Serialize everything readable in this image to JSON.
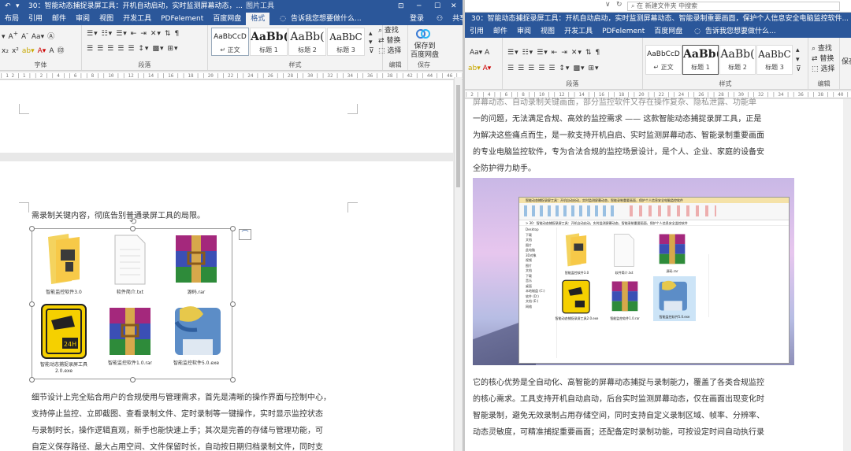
{
  "left": {
    "title": "30：智能动态捕捉录屏工具：开机自动启动，实时监测屏幕动态，...",
    "picture_tools": "图片工具",
    "menu": [
      "布局",
      "引用",
      "邮件",
      "审阅",
      "视图",
      "开发工具",
      "PDFelement",
      "百度网盘",
      "格式"
    ],
    "active_menu": "格式",
    "tell_me": "告诉我您想要做什么...",
    "login": "登录",
    "share": "共享",
    "font_label": "字体",
    "para_label": "段落",
    "style_label": "样式",
    "edit_label": "编辑",
    "save_label": "保存",
    "styles": [
      {
        "sample": "AaBbCcD",
        "name": "↵ 正文"
      },
      {
        "sample": "AaBb(",
        "name": "标题 1"
      },
      {
        "sample": "AaBb(",
        "name": "标题 2"
      },
      {
        "sample": "AaBbC",
        "name": "标题 3"
      }
    ],
    "find": "查找",
    "replace": "替换",
    "select": "选择",
    "save_to": "保存到",
    "baidu_disk": "百度网盘",
    "ruler_text": "| 1 2 | 1 | | 2 | | 4 | | 6 | | 8 | | 10 | | 12 | | 14 | | 16 | | 18 | | 20 | | 22 | | 24 | | 26 | | 28 | | 30 | | 32 | | 34 | | 36 | | 38 | | 42 | | 44 | | 46 | | 48",
    "line1": "需录制关键内容，彻底告别普通录屏工具的局限。",
    "icons": [
      {
        "name": "智能监控软件3.0",
        "kind": "folder"
      },
      {
        "name": "软件简介.txt",
        "kind": "doc"
      },
      {
        "name": "源码.rar",
        "kind": "rar"
      },
      {
        "name": "智能动态捕捉录屏工具2.0.exe",
        "kind": "cam"
      },
      {
        "name": "智能监控软件1.0.rar",
        "kind": "rar"
      },
      {
        "name": "智能监控软件5.0.exe",
        "kind": "py"
      }
    ],
    "para": [
      "细节设计上完全贴合用户的合规使用与管理需求，首先是清晰的操作界面与控制中心，",
      "支持停止监控、立即截图、查看录制文件、定时录制等一键操作，实时显示监控状态",
      "与录制时长，操作逻辑直观，新手也能快速上手；其次是完善的存储与管理功能，可",
      "自定义保存路径、最大占用空间、文件保留时长，自动按日期归档录制文件，同时支"
    ]
  },
  "right": {
    "title": "30：智能动态捕捉录屏工具：开机自动启动，实时监测屏幕动态、智能录制重要画面，保护个人信息安全电脑监控软件...",
    "explorer_search": "在 新建文件夹 中搜索",
    "menu": [
      "引用",
      "邮件",
      "审阅",
      "视图",
      "开发工具",
      "PDFelement",
      "百度网盘"
    ],
    "tell_me": "告诉我您想要做什么...",
    "para_label": "段落",
    "style_label": "样式",
    "edit_label": "编辑",
    "styles": [
      {
        "sample": "AaBbCcD",
        "name": "↵ 正文"
      },
      {
        "sample": "AaBb(",
        "name": "标题 1"
      },
      {
        "sample": "AaBb(",
        "name": "标题 2"
      },
      {
        "sample": "AaBbC",
        "name": "标题 3"
      }
    ],
    "find": "查找",
    "replace": "替换",
    "select": "选择",
    "save_short": "保存百",
    "ruler_text": "| 2 | | 4 | | 6 | | 8 | | 10 | | 12 | | 14 | | 16 | | 18 | | 20 | | 22 | | 24 | | 26 | | 28 | | 30 | | 32 | | 34 | | 36 | | 38 | | 40 | | 42 | | 44 | | 46 | | 48",
    "top_lines": [
      "屏幕动态、自动录制关键画面，部分监控软件又存在操作复杂、隐私泄露、功能单",
      "一的问题，无法满足合规、高效的监控需求 —— 这款智能动态捕捉录屏工具，正是",
      "为解决这些痛点而生，是一款支持开机自启、实时监测屏幕动态、智能录制重要画面",
      "的专业电脑监控软件，专为合法合规的监控场景设计，是个人、企业、家庭的设备安",
      "全防护得力助手。"
    ],
    "bottom_lines": [
      "它的核心优势是全自动化、高智能的屏幕动态捕捉与录制能力，覆盖了各类合规监控",
      "的核心需求。工具支持开机自动启动，后台实时监测屏幕动态，仅在画面出现变化时",
      "智能录制，避免无效录制占用存储空间，同时支持自定义录制区域、帧率、分辨率、",
      "动态灵敏度，可精准捕捉重要画面；还配备定时录制功能，可按设定时间自动执行录"
    ],
    "screenshot_bar": "智能动态捕捉录屏工具：开机自动启动，实时监测屏幕动态，智能录制重要画面，保护个人信息安全电脑监控软件",
    "screenshot_path": "> 30：智能动态捕捉录屏工具：开机自动启动，实时监测屏幕动态，智能录制重要画面，保护个人信息安全监控软件",
    "screenshot_icons": [
      "智能监控软件3.0",
      "软件简介.txt",
      "源码.rar",
      "智能动态捕捉录屏工具2.0.exe",
      "智能监控软件1.0.rar",
      "智能监控软件5.0.exe"
    ],
    "side_items": [
      "Desktop",
      "下载",
      "文档",
      "图片",
      "此电脑",
      "3D对象",
      "视频",
      "图片",
      "文档",
      "下载",
      "音乐",
      "桌面",
      "本地磁盘 (C:)",
      "软件 (D:)",
      "文档 (E:)",
      "网络"
    ]
  }
}
